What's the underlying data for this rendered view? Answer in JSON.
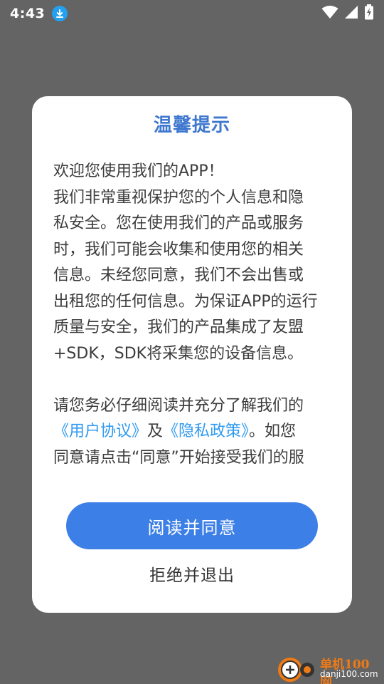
{
  "status_bar": {
    "time": "4:43",
    "icons": [
      "download-icon",
      "wifi-icon",
      "signal-icon",
      "battery-charging-icon"
    ]
  },
  "dialog": {
    "title": "温馨提示",
    "paragraph1": [
      "欢迎您使用我们的APP！",
      "我们非常重视保护您的个人信息和隐",
      "私安全。您在使用我们的产品或服务",
      "时，我们可能会收集和使用您的相关",
      "信息。未经您同意，我们不会出售或",
      "出租您的任何信息。为保证APP的运行",
      "质量与安全，我们的产品集成了友盟",
      "+SDK，SDK将采集您的设备信息。"
    ],
    "paragraph2_line1": "请您务必仔细阅读并充分了解我们的",
    "user_agreement_link": "《用户协议》",
    "and_text": "及",
    "privacy_policy_link": "《隐私政策》",
    "after_links": "。如您",
    "paragraph2_line3": "同意请点击“同意”开始接受我们的服",
    "agree_button": "阅读并同意",
    "reject_button": "拒绝并退出"
  },
  "watermark": {
    "title": "单机100网",
    "domain": "danji100.com"
  },
  "colors": {
    "overlay": "#646464",
    "title": "#3f78cf",
    "link": "#2f9af0",
    "button": "#3c7fe6"
  }
}
